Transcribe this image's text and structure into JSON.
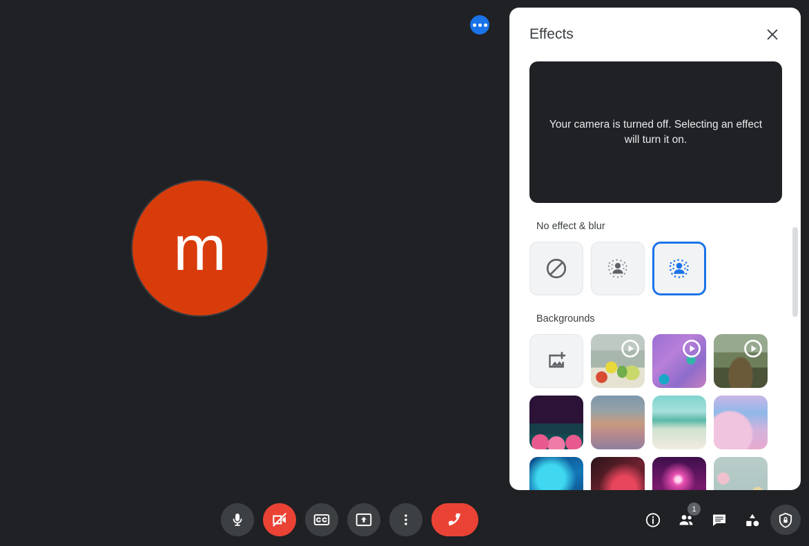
{
  "meeting": {
    "avatar_initial": "m",
    "avatar_color": "#d93c0b",
    "background_color": "#202124",
    "accent_color": "#1a73e8",
    "danger_color": "#ea4335"
  },
  "floating_button": {
    "name": "more-options-floating",
    "label": "•••"
  },
  "effects_panel": {
    "title": "Effects",
    "close_label": "Close",
    "preview_message": "Your camera is turned off. Selecting an effect will turn it on.",
    "sections": [
      {
        "title": "No effect & blur",
        "items": [
          {
            "name": "no-effect",
            "icon": "block-icon",
            "selected": false
          },
          {
            "name": "slight-blur",
            "icon": "slight-blur-icon",
            "selected": false
          },
          {
            "name": "blur",
            "icon": "blur-icon",
            "selected": true
          }
        ]
      },
      {
        "title": "Backgrounds",
        "items": [
          {
            "name": "upload-background",
            "icon": "add-image-icon",
            "art": "upload",
            "video": false
          },
          {
            "name": "background-kitchen",
            "art": "art-kitchen",
            "video": true
          },
          {
            "name": "background-purple-room",
            "art": "art-purple",
            "video": true
          },
          {
            "name": "background-forest",
            "art": "art-forest",
            "video": true
          },
          {
            "name": "background-night-party",
            "art": "art-night",
            "video": false
          },
          {
            "name": "background-dusk-gradient",
            "art": "art-dusk",
            "video": false
          },
          {
            "name": "background-beach",
            "art": "art-beach",
            "video": false
          },
          {
            "name": "background-pink-clouds",
            "art": "art-clouds",
            "video": false
          },
          {
            "name": "background-aurora",
            "art": "art-aurora",
            "video": false
          },
          {
            "name": "background-nebula",
            "art": "art-nebula",
            "video": false
          },
          {
            "name": "background-fireworks",
            "art": "art-fireworks",
            "video": false
          },
          {
            "name": "background-flowers",
            "art": "art-flowers",
            "video": false
          }
        ]
      }
    ]
  },
  "bottom_bar": {
    "controls": [
      {
        "name": "microphone-button",
        "icon": "mic-icon",
        "state": "on",
        "style": "normal"
      },
      {
        "name": "camera-button",
        "icon": "camera-off-icon",
        "state": "off",
        "style": "danger"
      },
      {
        "name": "captions-button",
        "icon": "cc-icon",
        "state": "off",
        "style": "normal"
      },
      {
        "name": "present-button",
        "icon": "present-screen-icon",
        "state": "off",
        "style": "normal"
      },
      {
        "name": "more-options-button",
        "icon": "more-vert-icon",
        "state": "off",
        "style": "normal"
      },
      {
        "name": "leave-call-button",
        "icon": "end-call-icon",
        "state": "on",
        "style": "hangup"
      }
    ],
    "right_controls": [
      {
        "name": "meeting-details-button",
        "icon": "info-icon",
        "badge": null,
        "active": false
      },
      {
        "name": "people-button",
        "icon": "people-icon",
        "badge": "1",
        "active": false
      },
      {
        "name": "chat-button",
        "icon": "chat-icon",
        "badge": null,
        "active": false
      },
      {
        "name": "activities-button",
        "icon": "activities-icon",
        "badge": null,
        "active": false
      },
      {
        "name": "host-controls-button",
        "icon": "shield-lock-icon",
        "badge": null,
        "active": true
      }
    ]
  }
}
